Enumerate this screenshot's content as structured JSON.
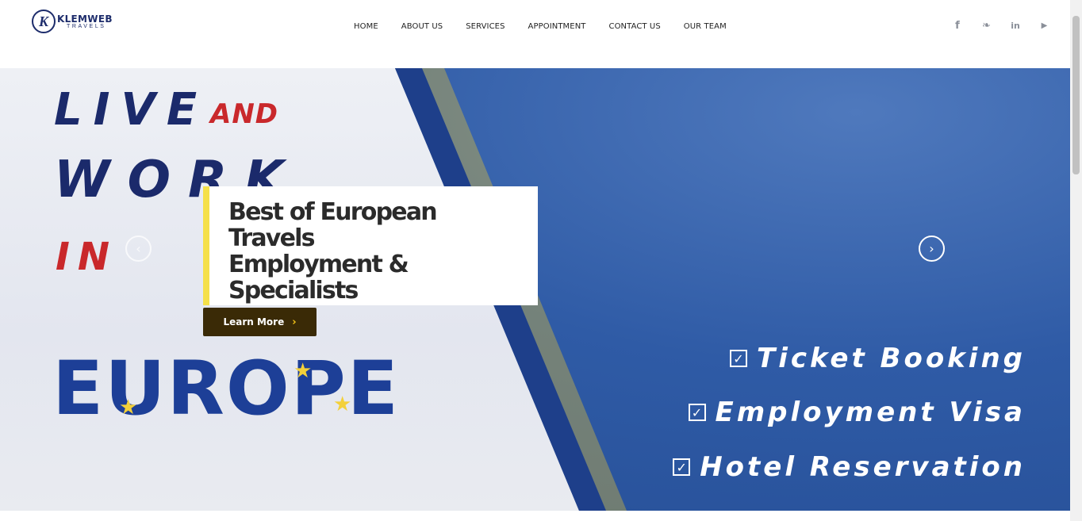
{
  "brand": {
    "logo_letter": "K",
    "name": "KLEMWEB",
    "sub": "TRAVELS"
  },
  "nav": {
    "items": [
      {
        "label": "HOME"
      },
      {
        "label": "ABOUT US"
      },
      {
        "label": "SERVICES"
      },
      {
        "label": "APPOINTMENT"
      },
      {
        "label": "CONTACT US"
      },
      {
        "label": "OUR TEAM"
      }
    ]
  },
  "social": {
    "icons": [
      "facebook-icon",
      "twitter-icon",
      "linkedin-icon",
      "youtube-icon"
    ],
    "glyphs": [
      "f",
      "❧",
      "in",
      "▶"
    ]
  },
  "hero": {
    "word_live": "LIVE",
    "word_and": "AND",
    "word_work": "WORK",
    "word_in": "IN",
    "word_europe": "EUROPE",
    "caption_title_lines": [
      "Best of European",
      "Travels",
      "Employment &",
      "Specialists"
    ],
    "button_label": "Learn More",
    "button_chevron": "›",
    "prev_arrow": "‹",
    "next_arrow": "›",
    "services": [
      {
        "label": "Ticket Booking",
        "check": "✓"
      },
      {
        "label": "Employment Visa",
        "check": "✓"
      },
      {
        "label": "Hotel Reservation",
        "check": "✓"
      }
    ]
  },
  "colors": {
    "brand_navy": "#1b2a6b",
    "accent_red": "#c9282b",
    "accent_yellow": "#f5e04a",
    "button_bg": "#3a2a06",
    "hero_blue": "#2f5ba6"
  }
}
